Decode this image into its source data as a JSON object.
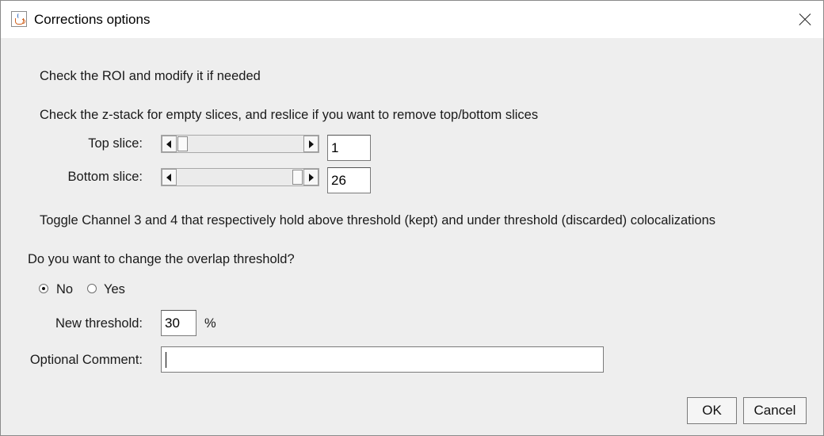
{
  "window": {
    "title": "Corrections options",
    "icon": "java-cup-icon"
  },
  "messages": {
    "roi": "Check the ROI and modify it if needed",
    "zstack": "Check the z-stack for empty slices, and reslice if you want to remove top/bottom slices",
    "toggle": "Toggle Channel 3 and 4 that respectively hold above threshold (kept) and under threshold (discarded) colocalizations",
    "overlap_question": "Do you want to change the overlap threshold?"
  },
  "top_slice": {
    "label": "Top slice:",
    "value": "1",
    "slider_fraction": 0.0
  },
  "bottom_slice": {
    "label": "Bottom slice:",
    "value": "26",
    "slider_fraction": 1.0
  },
  "overlap_radio": {
    "options": [
      "No",
      "Yes"
    ],
    "selected": "No"
  },
  "threshold": {
    "label": "New threshold:",
    "value": "30",
    "unit": "%"
  },
  "comment": {
    "label": "Optional Comment:",
    "value": ""
  },
  "buttons": {
    "ok": "OK",
    "cancel": "Cancel"
  }
}
